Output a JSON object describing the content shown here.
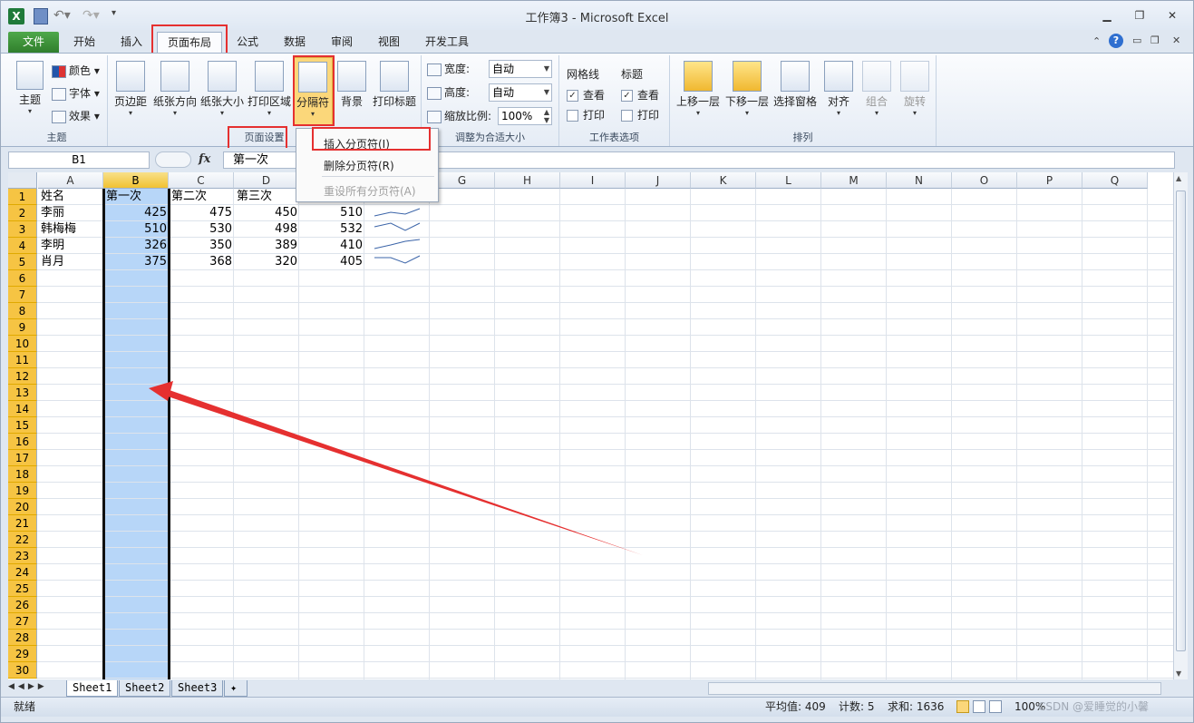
{
  "window": {
    "title": "工作簿3 - Microsoft Excel",
    "controls": {
      "minimize": "▁",
      "restore": "❐",
      "close": "✕"
    }
  },
  "quick_access": [
    "save-icon",
    "undo-icon",
    "redo-icon",
    "customize-icon"
  ],
  "tabs": [
    {
      "label": "文件"
    },
    {
      "label": "开始"
    },
    {
      "label": "插入"
    },
    {
      "label": "页面布局",
      "active": true
    },
    {
      "label": "公式"
    },
    {
      "label": "数据"
    },
    {
      "label": "审阅"
    },
    {
      "label": "视图"
    },
    {
      "label": "开发工具"
    }
  ],
  "ribbon": {
    "theme_group": {
      "label": "主题",
      "theme_btn": "主题",
      "colors": "颜色",
      "fonts": "字体",
      "effects": "效果"
    },
    "page_setup_group": {
      "label": "页面设置",
      "margins": "页边距",
      "orientation": "纸张方向",
      "size": "纸张大小",
      "print_area": "打印区域",
      "breaks": "分隔符",
      "background": "背景",
      "print_titles": "打印标题"
    },
    "scale_group": {
      "label": "调整为合适大小",
      "width_label": "宽度:",
      "width_value": "自动",
      "height_label": "高度:",
      "height_value": "自动",
      "scale_label": "缩放比例:",
      "scale_value": "100%"
    },
    "sheet_options_group": {
      "label": "工作表选项",
      "gridlines": "网格线",
      "headings": "标题",
      "view": "查看",
      "print": "打印"
    },
    "arrange_group": {
      "label": "排列",
      "bring_forward": "上移一层",
      "send_backward": "下移一层",
      "selection_pane": "选择窗格",
      "align": "对齐",
      "group": "组合",
      "rotate": "旋转"
    }
  },
  "breaks_menu": {
    "insert": "插入分页符(I)",
    "remove": "删除分页符(R)",
    "reset": "重设所有分页符(A)"
  },
  "formula_bar": {
    "name_box": "B1",
    "fx": "fx",
    "content": "第一次"
  },
  "columns": [
    "A",
    "B",
    "C",
    "D",
    "E",
    "F",
    "G",
    "H",
    "I",
    "J",
    "K",
    "L",
    "M",
    "N",
    "O",
    "P",
    "Q"
  ],
  "rows": [
    "1",
    "2",
    "3",
    "4",
    "5",
    "6",
    "7",
    "8",
    "9",
    "10",
    "11",
    "12",
    "13",
    "14",
    "15",
    "16",
    "17",
    "18",
    "19",
    "20",
    "21",
    "22",
    "23",
    "24",
    "25",
    "26",
    "27",
    "28",
    "29",
    "30"
  ],
  "table": {
    "headers": [
      "姓名",
      "第一次",
      "第二次",
      "第三次"
    ],
    "data": [
      {
        "name": "李丽",
        "v1": "425",
        "v2": "475",
        "v3": "450",
        "v4": "510"
      },
      {
        "name": "韩梅梅",
        "v1": "510",
        "v2": "530",
        "v3": "498",
        "v4": "532"
      },
      {
        "name": "李明",
        "v1": "326",
        "v2": "350",
        "v3": "389",
        "v4": "410"
      },
      {
        "name": "肖月",
        "v1": "375",
        "v2": "368",
        "v3": "320",
        "v4": "405"
      }
    ]
  },
  "sheet_tabs": [
    "Sheet1",
    "Sheet2",
    "Sheet3"
  ],
  "status": {
    "ready": "就绪",
    "average": "平均值: 409",
    "count": "计数: 5",
    "sum": "求和: 1636",
    "zoom": "100%",
    "watermark": "CSDN @爱睡觉的小馨"
  },
  "colors": {
    "accent_red": "#e53030",
    "selection": "#b7d6f8",
    "row_header": "#f6c443"
  }
}
